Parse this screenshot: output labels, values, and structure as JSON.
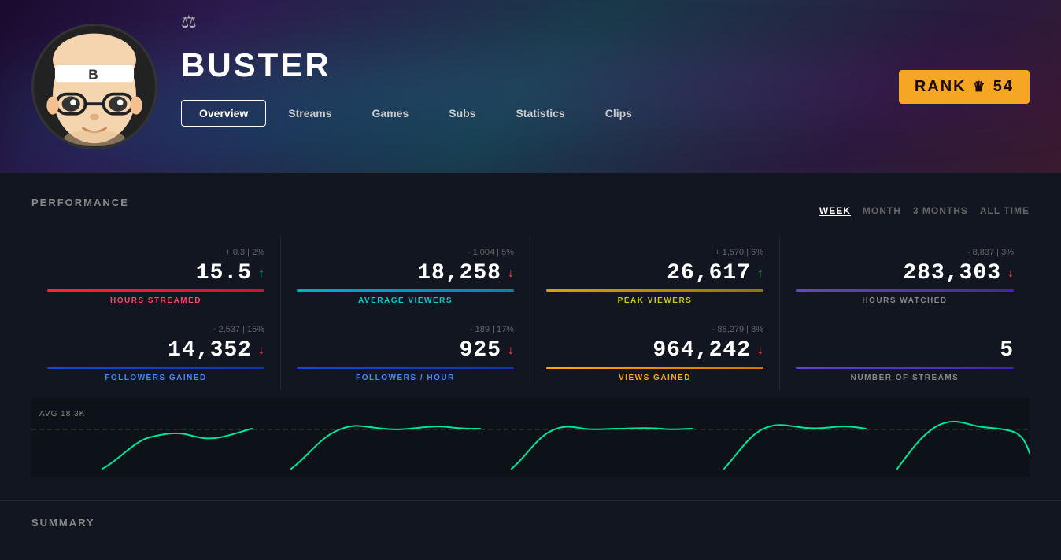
{
  "header": {
    "streamer_name": "BUSTER",
    "rank_label": "RANK",
    "rank_number": "54",
    "balance_icon": "⚖",
    "crown_icon": "♛"
  },
  "nav": {
    "tabs": [
      {
        "id": "overview",
        "label": "Overview",
        "active": true
      },
      {
        "id": "streams",
        "label": "Streams",
        "active": false
      },
      {
        "id": "games",
        "label": "Games",
        "active": false
      },
      {
        "id": "subs",
        "label": "Subs",
        "active": false
      },
      {
        "id": "statistics",
        "label": "Statistics",
        "active": false
      },
      {
        "id": "clips",
        "label": "Clips",
        "active": false
      }
    ]
  },
  "performance": {
    "section_title": "PERFORMANCE",
    "time_filters": [
      {
        "id": "week",
        "label": "WEEK",
        "active": true
      },
      {
        "id": "month",
        "label": "MONTH",
        "active": false
      },
      {
        "id": "3months",
        "label": "3 MONTHS",
        "active": false
      },
      {
        "id": "alltime",
        "label": "ALL TIME",
        "active": false
      }
    ],
    "stats_row1": [
      {
        "change": "+ 0.3 | 2%",
        "value": "15.5",
        "direction": "up",
        "bar_class": "bar-red",
        "label": "HOURS STREAMED",
        "label_class": "label-red"
      },
      {
        "change": "- 1,004 | 5%",
        "value": "18,258",
        "direction": "down",
        "bar_class": "bar-teal",
        "label": "AVERAGE VIEWERS",
        "label_class": "label-teal"
      },
      {
        "change": "+ 1,570 | 6%",
        "value": "26,617",
        "direction": "up",
        "bar_class": "bar-yellow",
        "label": "PEAK VIEWERS",
        "label_class": "label-yellow"
      },
      {
        "change": "- 8,837 | 3%",
        "value": "283,303",
        "direction": "down",
        "bar_class": "bar-purple",
        "label": "HOURS WATCHED",
        "label_class": "label-gray"
      }
    ],
    "stats_row2": [
      {
        "change": "- 2,537 | 15%",
        "value": "14,352",
        "direction": "down",
        "bar_class": "bar-blue",
        "label": "FOLLOWERS GAINED",
        "label_class": "label-blue"
      },
      {
        "change": "- 189 | 17%",
        "value": "925",
        "direction": "down",
        "bar_class": "bar-blue",
        "label": "FOLLOWERS / HOUR",
        "label_class": "label-blue"
      },
      {
        "change": "- 88,279 | 8%",
        "value": "964,242",
        "direction": "down",
        "bar_class": "bar-orange",
        "label": "VIEWS GAINED",
        "label_class": "label-orange"
      },
      {
        "change": "",
        "value": "5",
        "direction": "none",
        "bar_class": "bar-purple",
        "label": "NUMBER OF STREAMS",
        "label_class": "label-gray"
      }
    ],
    "avg_label": "AVG 18.3K"
  },
  "summary": {
    "section_title": "SUMMARY"
  }
}
